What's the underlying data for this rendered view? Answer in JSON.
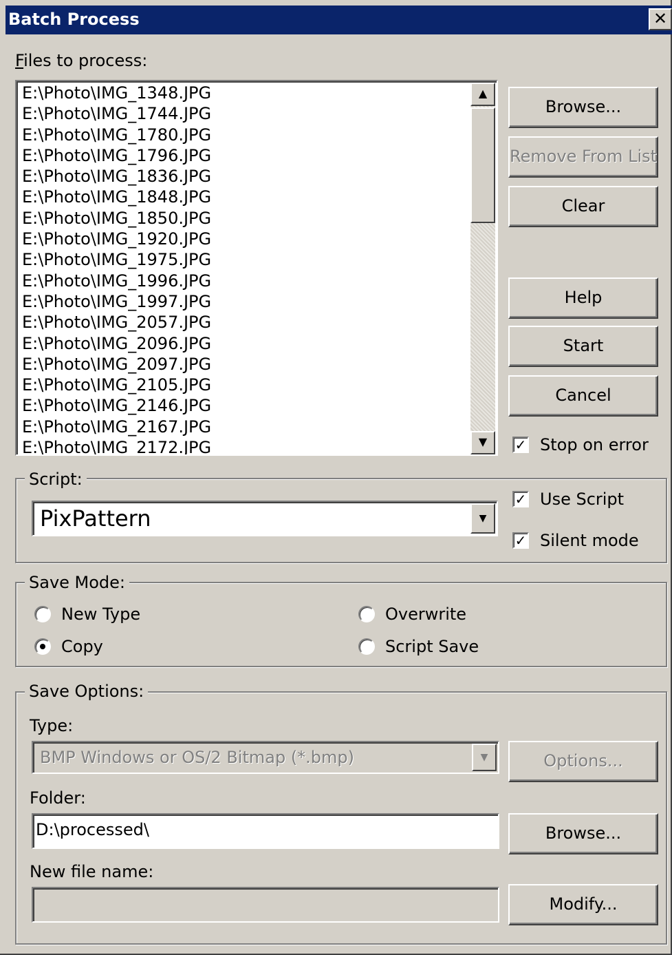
{
  "window": {
    "title": "Batch Process",
    "close_glyph": "✕"
  },
  "files": {
    "label": "Files to process:",
    "items": [
      "E:\\Photo\\IMG_1348.JPG",
      "E:\\Photo\\IMG_1744.JPG",
      "E:\\Photo\\IMG_1780.JPG",
      "E:\\Photo\\IMG_1796.JPG",
      "E:\\Photo\\IMG_1836.JPG",
      "E:\\Photo\\IMG_1848.JPG",
      "E:\\Photo\\IMG_1850.JPG",
      "E:\\Photo\\IMG_1920.JPG",
      "E:\\Photo\\IMG_1975.JPG",
      "E:\\Photo\\IMG_1996.JPG",
      "E:\\Photo\\IMG_1997.JPG",
      "E:\\Photo\\IMG_2057.JPG",
      "E:\\Photo\\IMG_2096.JPG",
      "E:\\Photo\\IMG_2097.JPG",
      "E:\\Photo\\IMG_2105.JPG",
      "E:\\Photo\\IMG_2146.JPG",
      "E:\\Photo\\IMG_2167.JPG",
      "E:\\Photo\\IMG_2172.JPG"
    ]
  },
  "buttons": {
    "browse": "Browse...",
    "remove": "Remove From List",
    "clear": "Clear",
    "help": "Help",
    "start": "Start",
    "cancel": "Cancel",
    "options": "Options...",
    "folder_browse": "Browse...",
    "modify": "Modify..."
  },
  "stop_on_error": {
    "label": "Stop on error",
    "checked": true
  },
  "script": {
    "group_label": "Script:",
    "selected": "PixPattern",
    "use_script": {
      "label": "Use Script",
      "checked": true
    },
    "silent_mode": {
      "label": "Silent mode",
      "checked": true
    }
  },
  "save_mode": {
    "group_label": "Save Mode:",
    "options": [
      {
        "label": "New Type",
        "selected": false
      },
      {
        "label": "Copy",
        "selected": true
      },
      {
        "label": "Overwrite",
        "selected": false
      },
      {
        "label": "Script Save",
        "selected": false
      }
    ]
  },
  "save_options": {
    "group_label": "Save Options:",
    "type_label": "Type:",
    "type_value": "BMP Windows or OS/2 Bitmap (*.bmp)",
    "folder_label": "Folder:",
    "folder_value": "D:\\processed\\",
    "new_file_name_label": "New file name:",
    "new_file_name_value": ""
  },
  "glyphs": {
    "up_arrow": "▲",
    "down_arrow": "▼",
    "check": "✓"
  },
  "colors": {
    "face": "#d4d0c8",
    "title_bar": "#0a246a",
    "disabled_text": "#808080"
  }
}
